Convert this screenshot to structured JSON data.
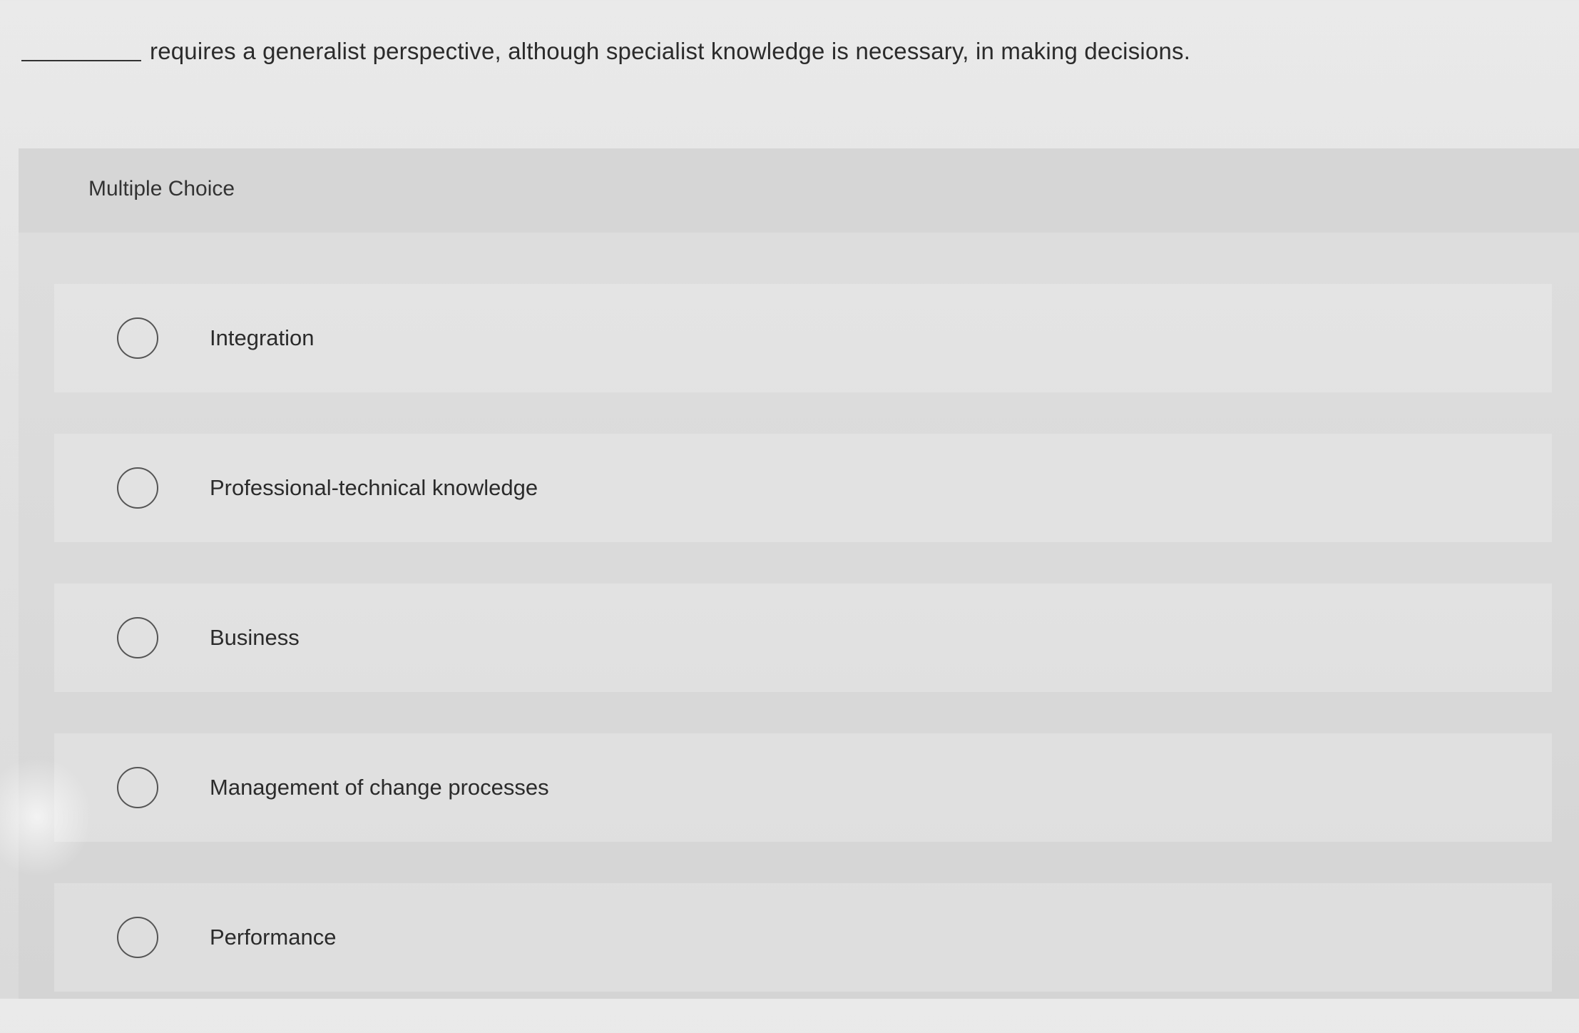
{
  "question": {
    "text": "requires a generalist perspective, although specialist knowledge is necessary, in making decisions."
  },
  "section": {
    "label": "Multiple Choice"
  },
  "options": [
    {
      "label": "Integration",
      "selected": false
    },
    {
      "label": "Professional-technical knowledge",
      "selected": false
    },
    {
      "label": "Business",
      "selected": false
    },
    {
      "label": "Management of change processes",
      "selected": false
    },
    {
      "label": "Performance",
      "selected": false
    }
  ]
}
